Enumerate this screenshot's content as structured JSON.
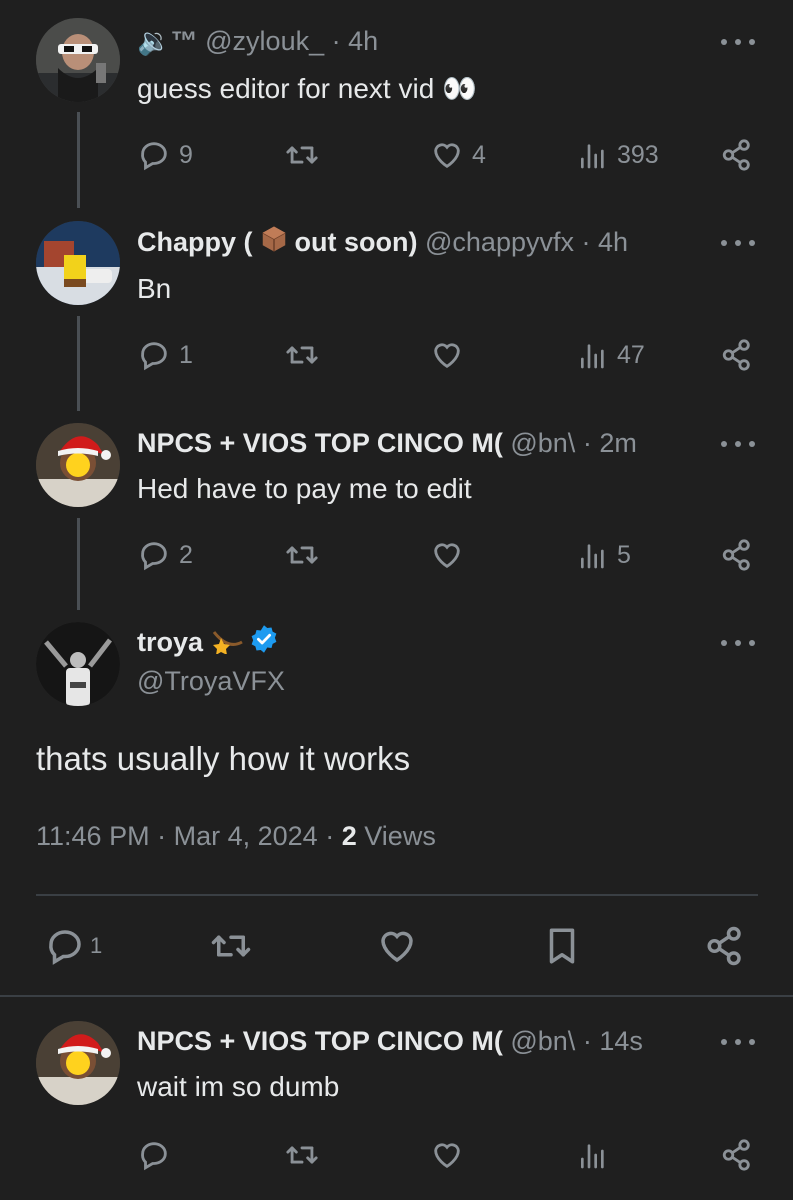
{
  "tweets": [
    {
      "name": "🔉™",
      "handle": "@zylouk_",
      "time": "4h",
      "text": "guess editor for next vid 👀",
      "replies": "9",
      "likes": "4",
      "views": "393"
    },
    {
      "name_prefix": "Chappy (",
      "name_suffix": "out soon)",
      "handle": "@chappyvfx",
      "time": "4h",
      "text": "Bn",
      "replies": "1",
      "likes": "",
      "views": "47"
    },
    {
      "name": "NPCS + VIOS TOP CINCO M(",
      "handle": "@bn\\",
      "time": "2m",
      "text": "Hed have to pay me to edit",
      "replies": "2",
      "likes": "",
      "views": "5"
    }
  ],
  "main": {
    "name": "troya",
    "handle": "@TroyaVFX",
    "text": "thats usually how it works",
    "time": "11:46 PM",
    "date": "Mar 4, 2024",
    "views_count": "2",
    "views_label": "Views",
    "replies": "1"
  },
  "reply": {
    "name": "NPCS + VIOS TOP CINCO M(",
    "handle": "@bn\\",
    "time": "14s",
    "text": "wait im so dumb"
  },
  "separator": "·",
  "icons": [
    "reply-icon",
    "retweet-icon",
    "like-icon",
    "views-icon",
    "share-icon",
    "bookmark-icon",
    "more-icon",
    "verified-icon"
  ],
  "colors": {
    "background": "#1f1f1f",
    "text": "#e7e9ea",
    "muted": "#8b9197",
    "verified": "#1d9bf0"
  }
}
